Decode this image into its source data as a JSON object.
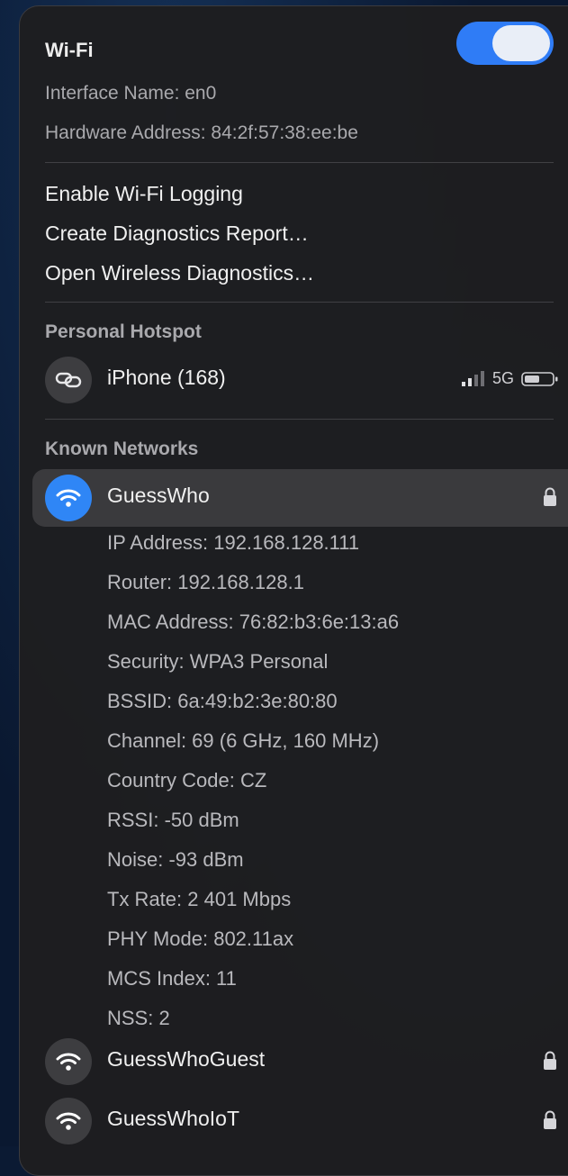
{
  "wifi": {
    "title": "Wi-Fi",
    "enabled": true,
    "toggle_color": "#2f7cf6"
  },
  "info": {
    "interface_name": "Interface Name: en0",
    "hardware_address": "Hardware Address: 84:2f:57:38:ee:be"
  },
  "actions": {
    "enable_logging": "Enable Wi-Fi Logging",
    "create_report": "Create Diagnostics Report…",
    "open_diagnostics": "Open Wireless Diagnostics…"
  },
  "hotspot": {
    "section_label": "Personal Hotspot",
    "device_name": "iPhone (168)",
    "network_type": "5G",
    "icon": "link-icon",
    "signal_bars_active": 2,
    "signal_bars_total": 4,
    "battery_level": 0.55
  },
  "known": {
    "section_label": "Known Networks",
    "connected": {
      "name": "GuessWho",
      "icon": "wifi-icon",
      "locked": true,
      "details": [
        "IP Address: 192.168.128.111",
        "Router: 192.168.128.1",
        "MAC Address: 76:82:b3:6e:13:a6",
        "Security: WPA3 Personal",
        "BSSID: 6a:49:b2:3e:80:80",
        "Channel: 69 (6 GHz, 160 MHz)",
        "Country Code: CZ",
        "RSSI: -50 dBm",
        "Noise: -93 dBm",
        "Tx Rate: 2 401 Mbps",
        "PHY Mode: 802.11ax",
        "MCS Index: 11",
        "NSS: 2"
      ]
    },
    "others": [
      {
        "name": "GuessWhoGuest",
        "icon": "wifi-icon",
        "locked": true
      },
      {
        "name": "GuessWhoIoT",
        "icon": "wifi-icon",
        "locked": true
      }
    ]
  },
  "colors": {
    "accent": "#2f86f6",
    "panel": "#1e1e20",
    "highlight": "#3a3a3d"
  }
}
